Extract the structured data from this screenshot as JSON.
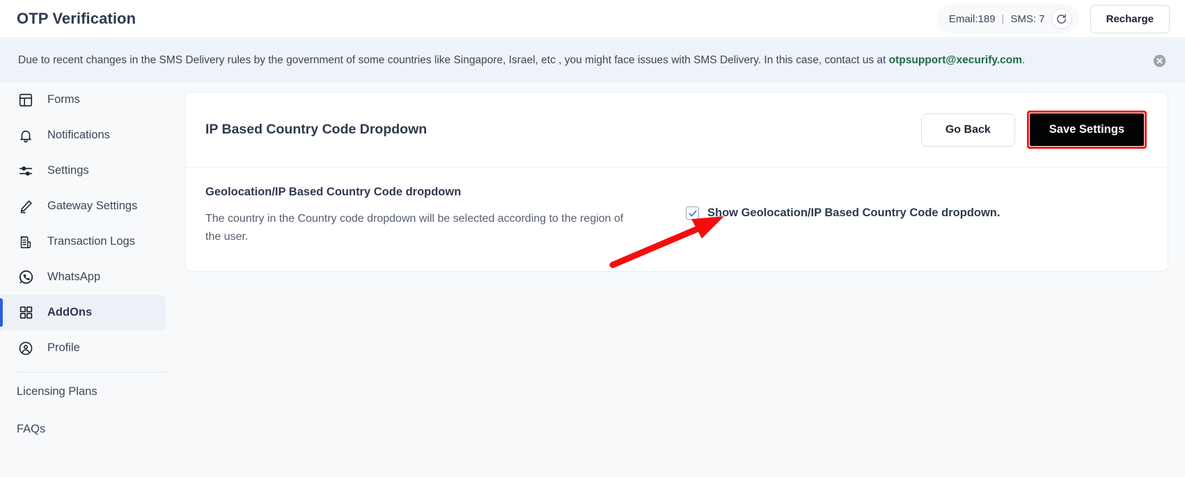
{
  "header": {
    "title": "OTP Verification",
    "credits": {
      "email_label": "Email:189",
      "separator": "|",
      "sms_label": "SMS: 7",
      "refresh_icon": "refresh-icon"
    },
    "recharge_label": "Recharge"
  },
  "banner": {
    "text_before": "Due to recent changes in the SMS Delivery rules by the government of some countries like Singapore, Israel, etc , you might face issues with SMS Delivery. In this case, contact us at ",
    "email": "otpsupport@xecurify.com",
    "text_after": ".",
    "close_icon": "close-circle-icon",
    "background": "#eef3fa",
    "email_color": "#1f6b45"
  },
  "sidebar": {
    "items": [
      {
        "label": "Forms",
        "icon": "layout-panel-icon",
        "active": false
      },
      {
        "label": "Notifications",
        "icon": "bell-icon",
        "active": false
      },
      {
        "label": "Settings",
        "icon": "sliders-icon",
        "active": false
      },
      {
        "label": "Gateway Settings",
        "icon": "pen-brush-icon",
        "active": false
      },
      {
        "label": "Transaction Logs",
        "icon": "receipt-list-icon",
        "active": false
      },
      {
        "label": "WhatsApp",
        "icon": "whatsapp-icon",
        "active": false
      },
      {
        "label": "AddOns",
        "icon": "grid-squares-icon",
        "active": true
      },
      {
        "label": "Profile",
        "icon": "user-circle-icon",
        "active": false
      }
    ],
    "plain_items": [
      {
        "label": "Licensing Plans"
      },
      {
        "label": "FAQs"
      }
    ],
    "active_accent": "#2b5cdd",
    "active_background": "#edf1f7"
  },
  "card": {
    "title": "IP Based Country Code Dropdown",
    "go_back_label": "Go Back",
    "save_label": "Save Settings",
    "save_highlight_color": "#ef1b1b",
    "save_background": "#020203",
    "setting": {
      "name": "Geolocation/IP Based Country Code dropdown",
      "description": "The country in the Country code dropdown will be selected according to the region of the user.",
      "checkbox_label": "Show Geolocation/IP Based Country Code dropdown.",
      "checkbox_checked": true,
      "checkbox_check_color": "#2f7fd8"
    }
  },
  "annotation": {
    "arrow_color": "#f40d0d",
    "arrow_target": "checkbox"
  }
}
